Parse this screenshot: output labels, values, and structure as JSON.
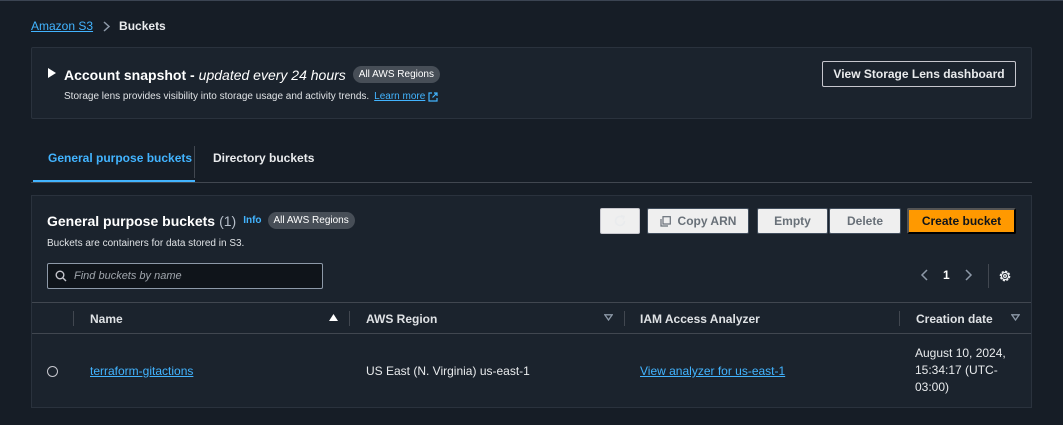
{
  "breadcrumb": {
    "root": "Amazon S3",
    "current": "Buckets"
  },
  "snapshot": {
    "title": "Account snapshot -",
    "subtitle": "updated every 24 hours",
    "badge": "All AWS Regions",
    "description": "Storage lens provides visibility into storage usage and activity trends.",
    "learn_more": "Learn more",
    "lens_button": "View Storage Lens dashboard"
  },
  "tabs": [
    {
      "label": "General purpose buckets",
      "active": true
    },
    {
      "label": "Directory buckets",
      "active": false
    }
  ],
  "panel": {
    "title": "General purpose buckets",
    "count": "(1)",
    "info": "Info",
    "badge": "All AWS Regions",
    "description": "Buckets are containers for data stored in S3.",
    "buttons": {
      "copy_arn": "Copy ARN",
      "empty": "Empty",
      "delete": "Delete",
      "create": "Create bucket"
    },
    "search_placeholder": "Find buckets by name",
    "page": "1"
  },
  "table": {
    "columns": [
      "Name",
      "AWS Region",
      "IAM Access Analyzer",
      "Creation date"
    ],
    "rows": [
      {
        "name": "terraform-gitactions",
        "region": "US East (N. Virginia) us-east-1",
        "iam": "View analyzer for us-east-1",
        "created_line1": "August 10, 2024,",
        "created_line2": "15:34:17 (UTC-",
        "created_line3": "03:00)"
      }
    ]
  },
  "colors": {
    "background": "#161d26",
    "panel": "#1b232d",
    "link": "#42b4ff",
    "primary": "#ff9900"
  }
}
